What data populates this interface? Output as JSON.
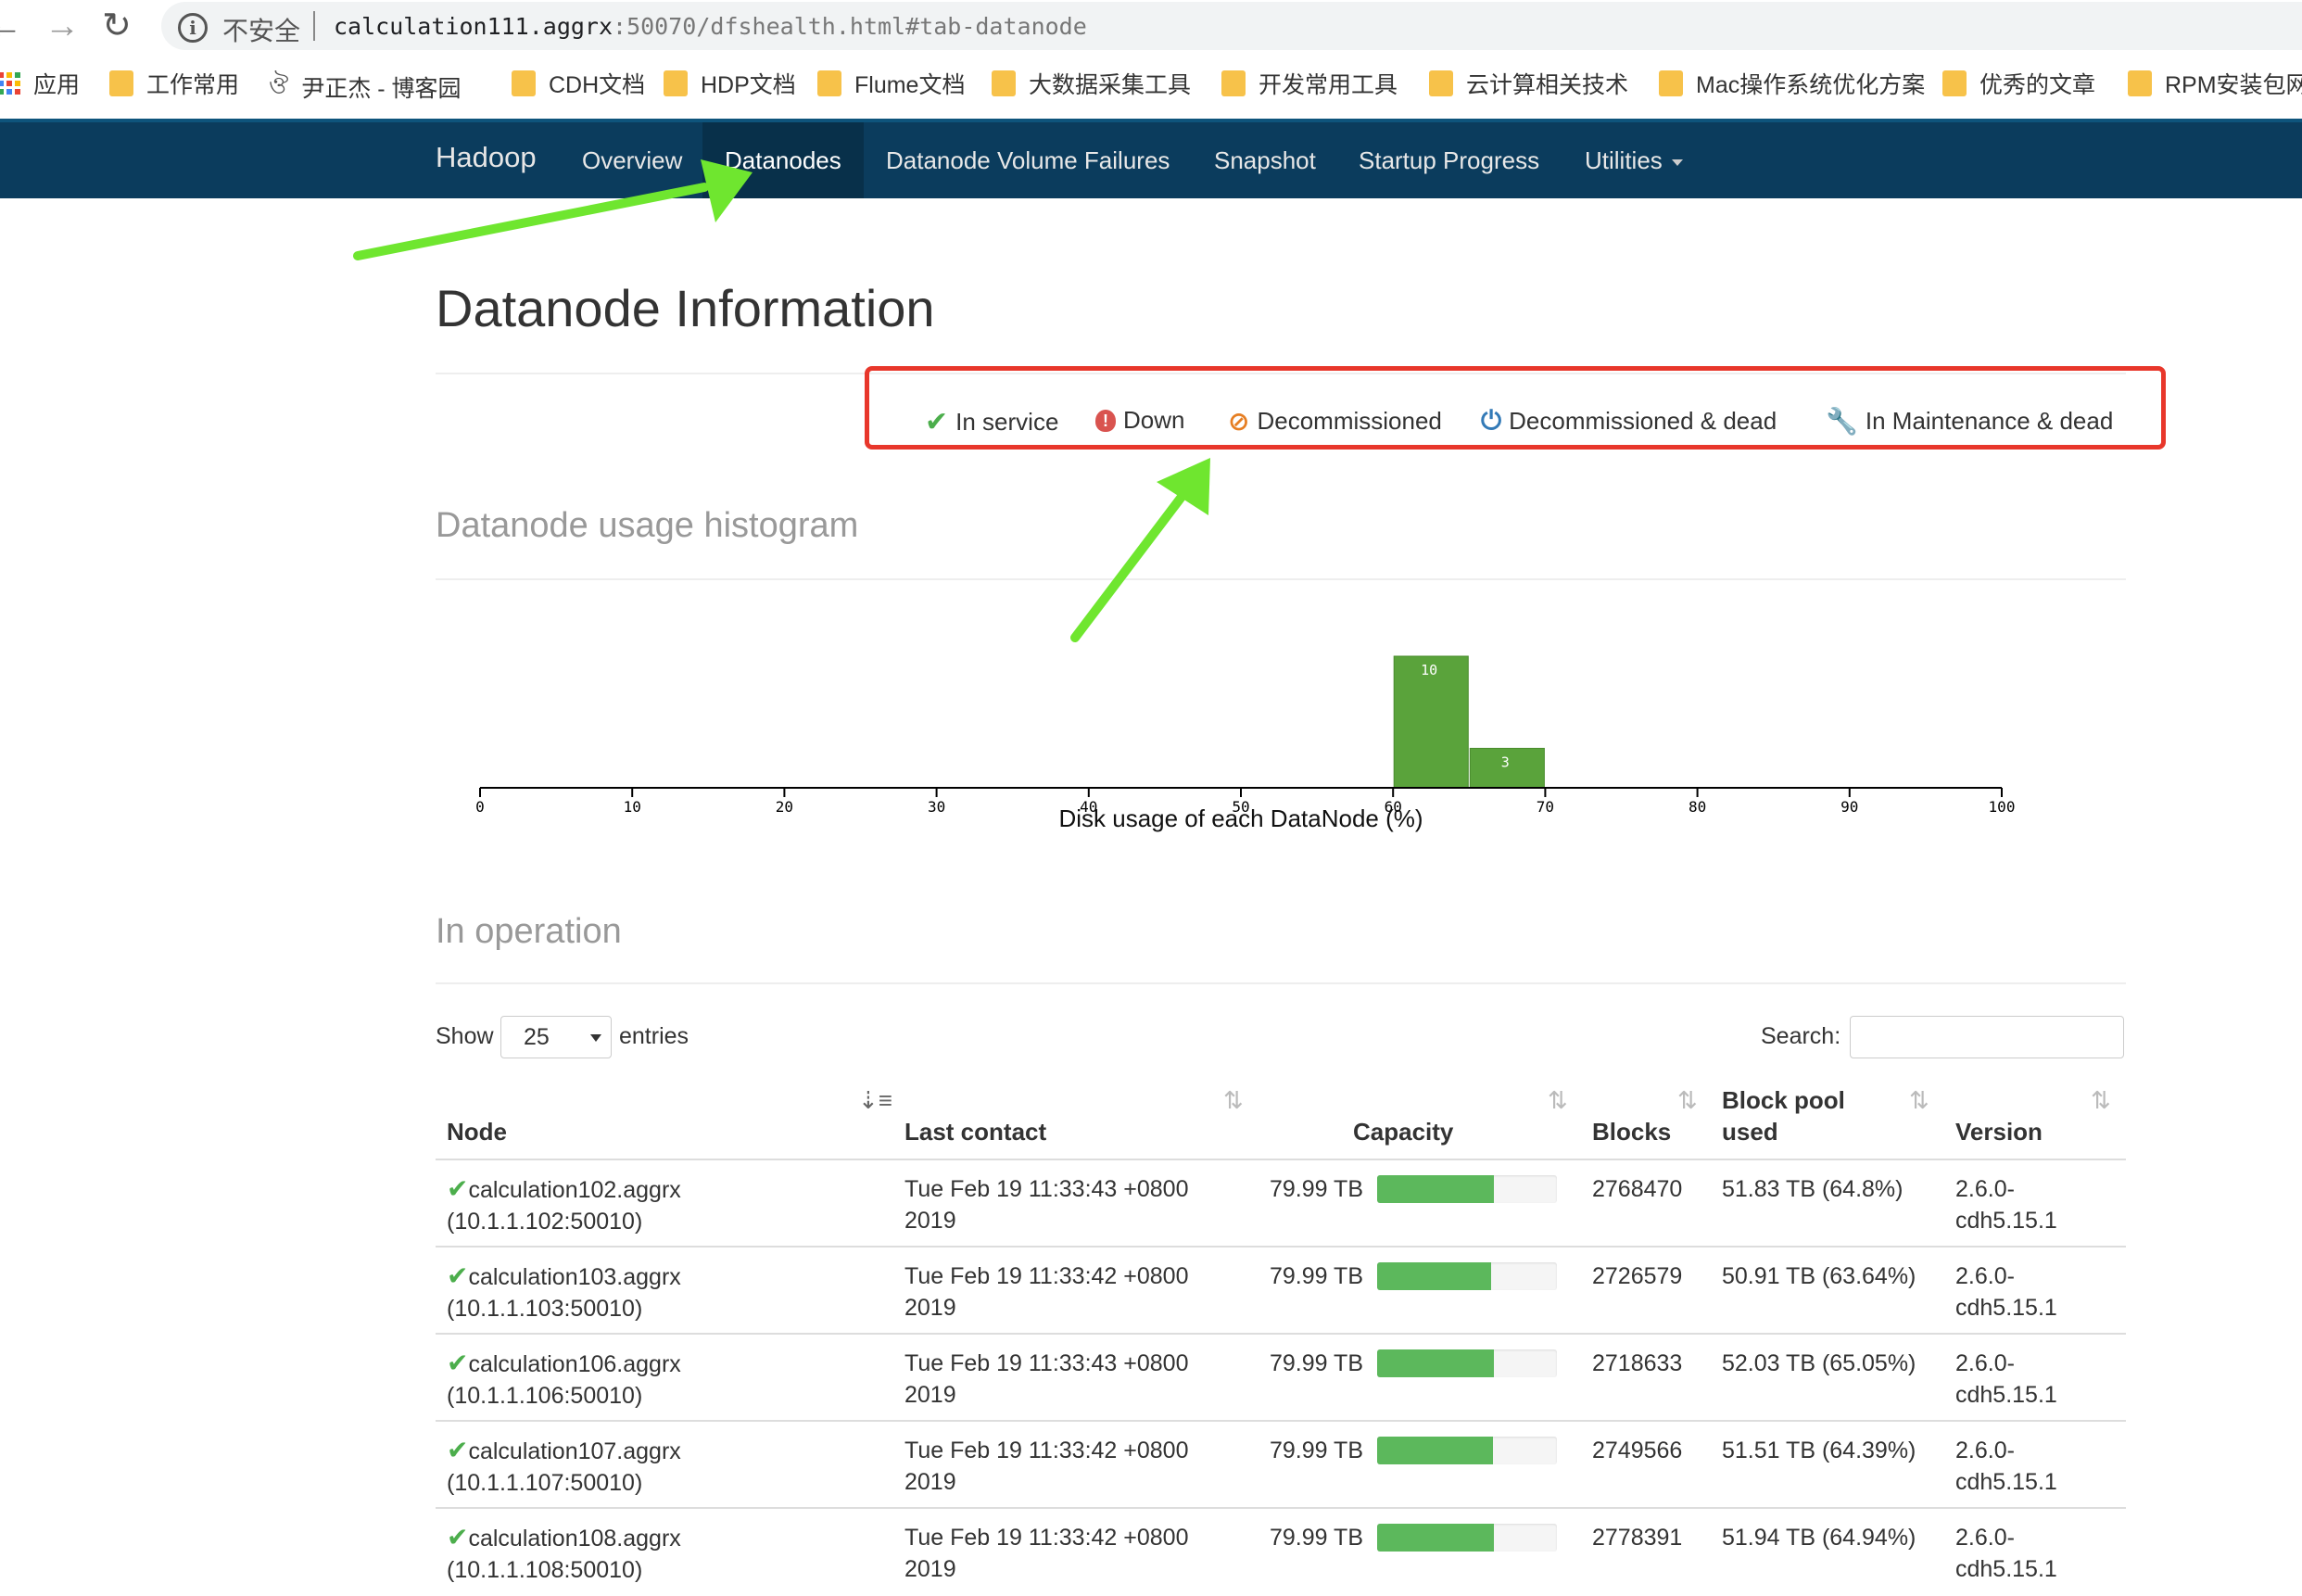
{
  "browser": {
    "insecure_label": "不安全",
    "url_host": "calculation111.aggrx",
    "url_rest": ":50070/dfshealth.html#tab-datanode",
    "bookmarks": [
      "应用",
      "工作常用",
      "尹正杰 - 博客园",
      "CDH文档",
      "HDP文档",
      "Flume文档",
      "大数据采集工具",
      "开发常用工具",
      "云计算相关技术",
      "Mac操作系统优化方案",
      "优秀的文章",
      "RPM安装包网站"
    ]
  },
  "navbar": {
    "brand": "Hadoop",
    "items": [
      "Overview",
      "Datanodes",
      "Datanode Volume Failures",
      "Snapshot",
      "Startup Progress",
      "Utilities"
    ],
    "active": "Datanodes"
  },
  "page": {
    "title": "Datanode Information",
    "legend": [
      "In service",
      "Down",
      "Decommissioned",
      "Decommissioned & dead",
      "In Maintenance & dead"
    ],
    "histogram_title": "Datanode usage histogram",
    "operation_title": "In operation"
  },
  "colors": {
    "navbar": "#0b3c5d",
    "highlight_box": "#e8372b",
    "bar_fill": "#5cb85c",
    "histogram_bar": "#5aa33b",
    "arrow": "#6fe62f"
  },
  "chart_data": {
    "type": "bar",
    "xlabel": "Disk usage of each DataNode (%)",
    "xlim": [
      0,
      100
    ],
    "xticks": [
      0,
      10,
      20,
      30,
      40,
      50,
      60,
      70,
      80,
      90,
      100
    ],
    "bins": [
      {
        "start": 60,
        "end": 65,
        "count": 10
      },
      {
        "start": 65,
        "end": 70,
        "count": 3
      }
    ]
  },
  "table": {
    "show_label": "Show",
    "page_size": "25",
    "entries_label": "entries",
    "search_label": "Search:",
    "headers": {
      "node": "Node",
      "last_contact": "Last contact",
      "capacity": "Capacity",
      "blocks": "Blocks",
      "block_pool_1": "Block pool",
      "block_pool_2": "used",
      "version": "Version"
    },
    "rows": [
      {
        "node": "calculation102.aggrx",
        "addr": "(10.1.1.102:50010)",
        "contact1": "Tue Feb 19 11:33:43 +0800",
        "contact2": "2019",
        "capacity": "79.99 TB",
        "used_pct": 64.8,
        "blocks": "2768470",
        "pool": "51.83 TB (64.8%)",
        "ver1": "2.6.0-",
        "ver2": "cdh5.15.1"
      },
      {
        "node": "calculation103.aggrx",
        "addr": "(10.1.1.103:50010)",
        "contact1": "Tue Feb 19 11:33:42 +0800",
        "contact2": "2019",
        "capacity": "79.99 TB",
        "used_pct": 63.64,
        "blocks": "2726579",
        "pool": "50.91 TB (63.64%)",
        "ver1": "2.6.0-",
        "ver2": "cdh5.15.1"
      },
      {
        "node": "calculation106.aggrx",
        "addr": "(10.1.1.106:50010)",
        "contact1": "Tue Feb 19 11:33:43 +0800",
        "contact2": "2019",
        "capacity": "79.99 TB",
        "used_pct": 65.05,
        "blocks": "2718633",
        "pool": "52.03 TB (65.05%)",
        "ver1": "2.6.0-",
        "ver2": "cdh5.15.1"
      },
      {
        "node": "calculation107.aggrx",
        "addr": "(10.1.1.107:50010)",
        "contact1": "Tue Feb 19 11:33:42 +0800",
        "contact2": "2019",
        "capacity": "79.99 TB",
        "used_pct": 64.39,
        "blocks": "2749566",
        "pool": "51.51 TB (64.39%)",
        "ver1": "2.6.0-",
        "ver2": "cdh5.15.1"
      },
      {
        "node": "calculation108.aggrx",
        "addr": "(10.1.1.108:50010)",
        "contact1": "Tue Feb 19 11:33:42 +0800",
        "contact2": "2019",
        "capacity": "79.99 TB",
        "used_pct": 64.94,
        "blocks": "2778391",
        "pool": "51.94 TB (64.94%)",
        "ver1": "2.6.0-",
        "ver2": "cdh5.15.1"
      }
    ]
  }
}
